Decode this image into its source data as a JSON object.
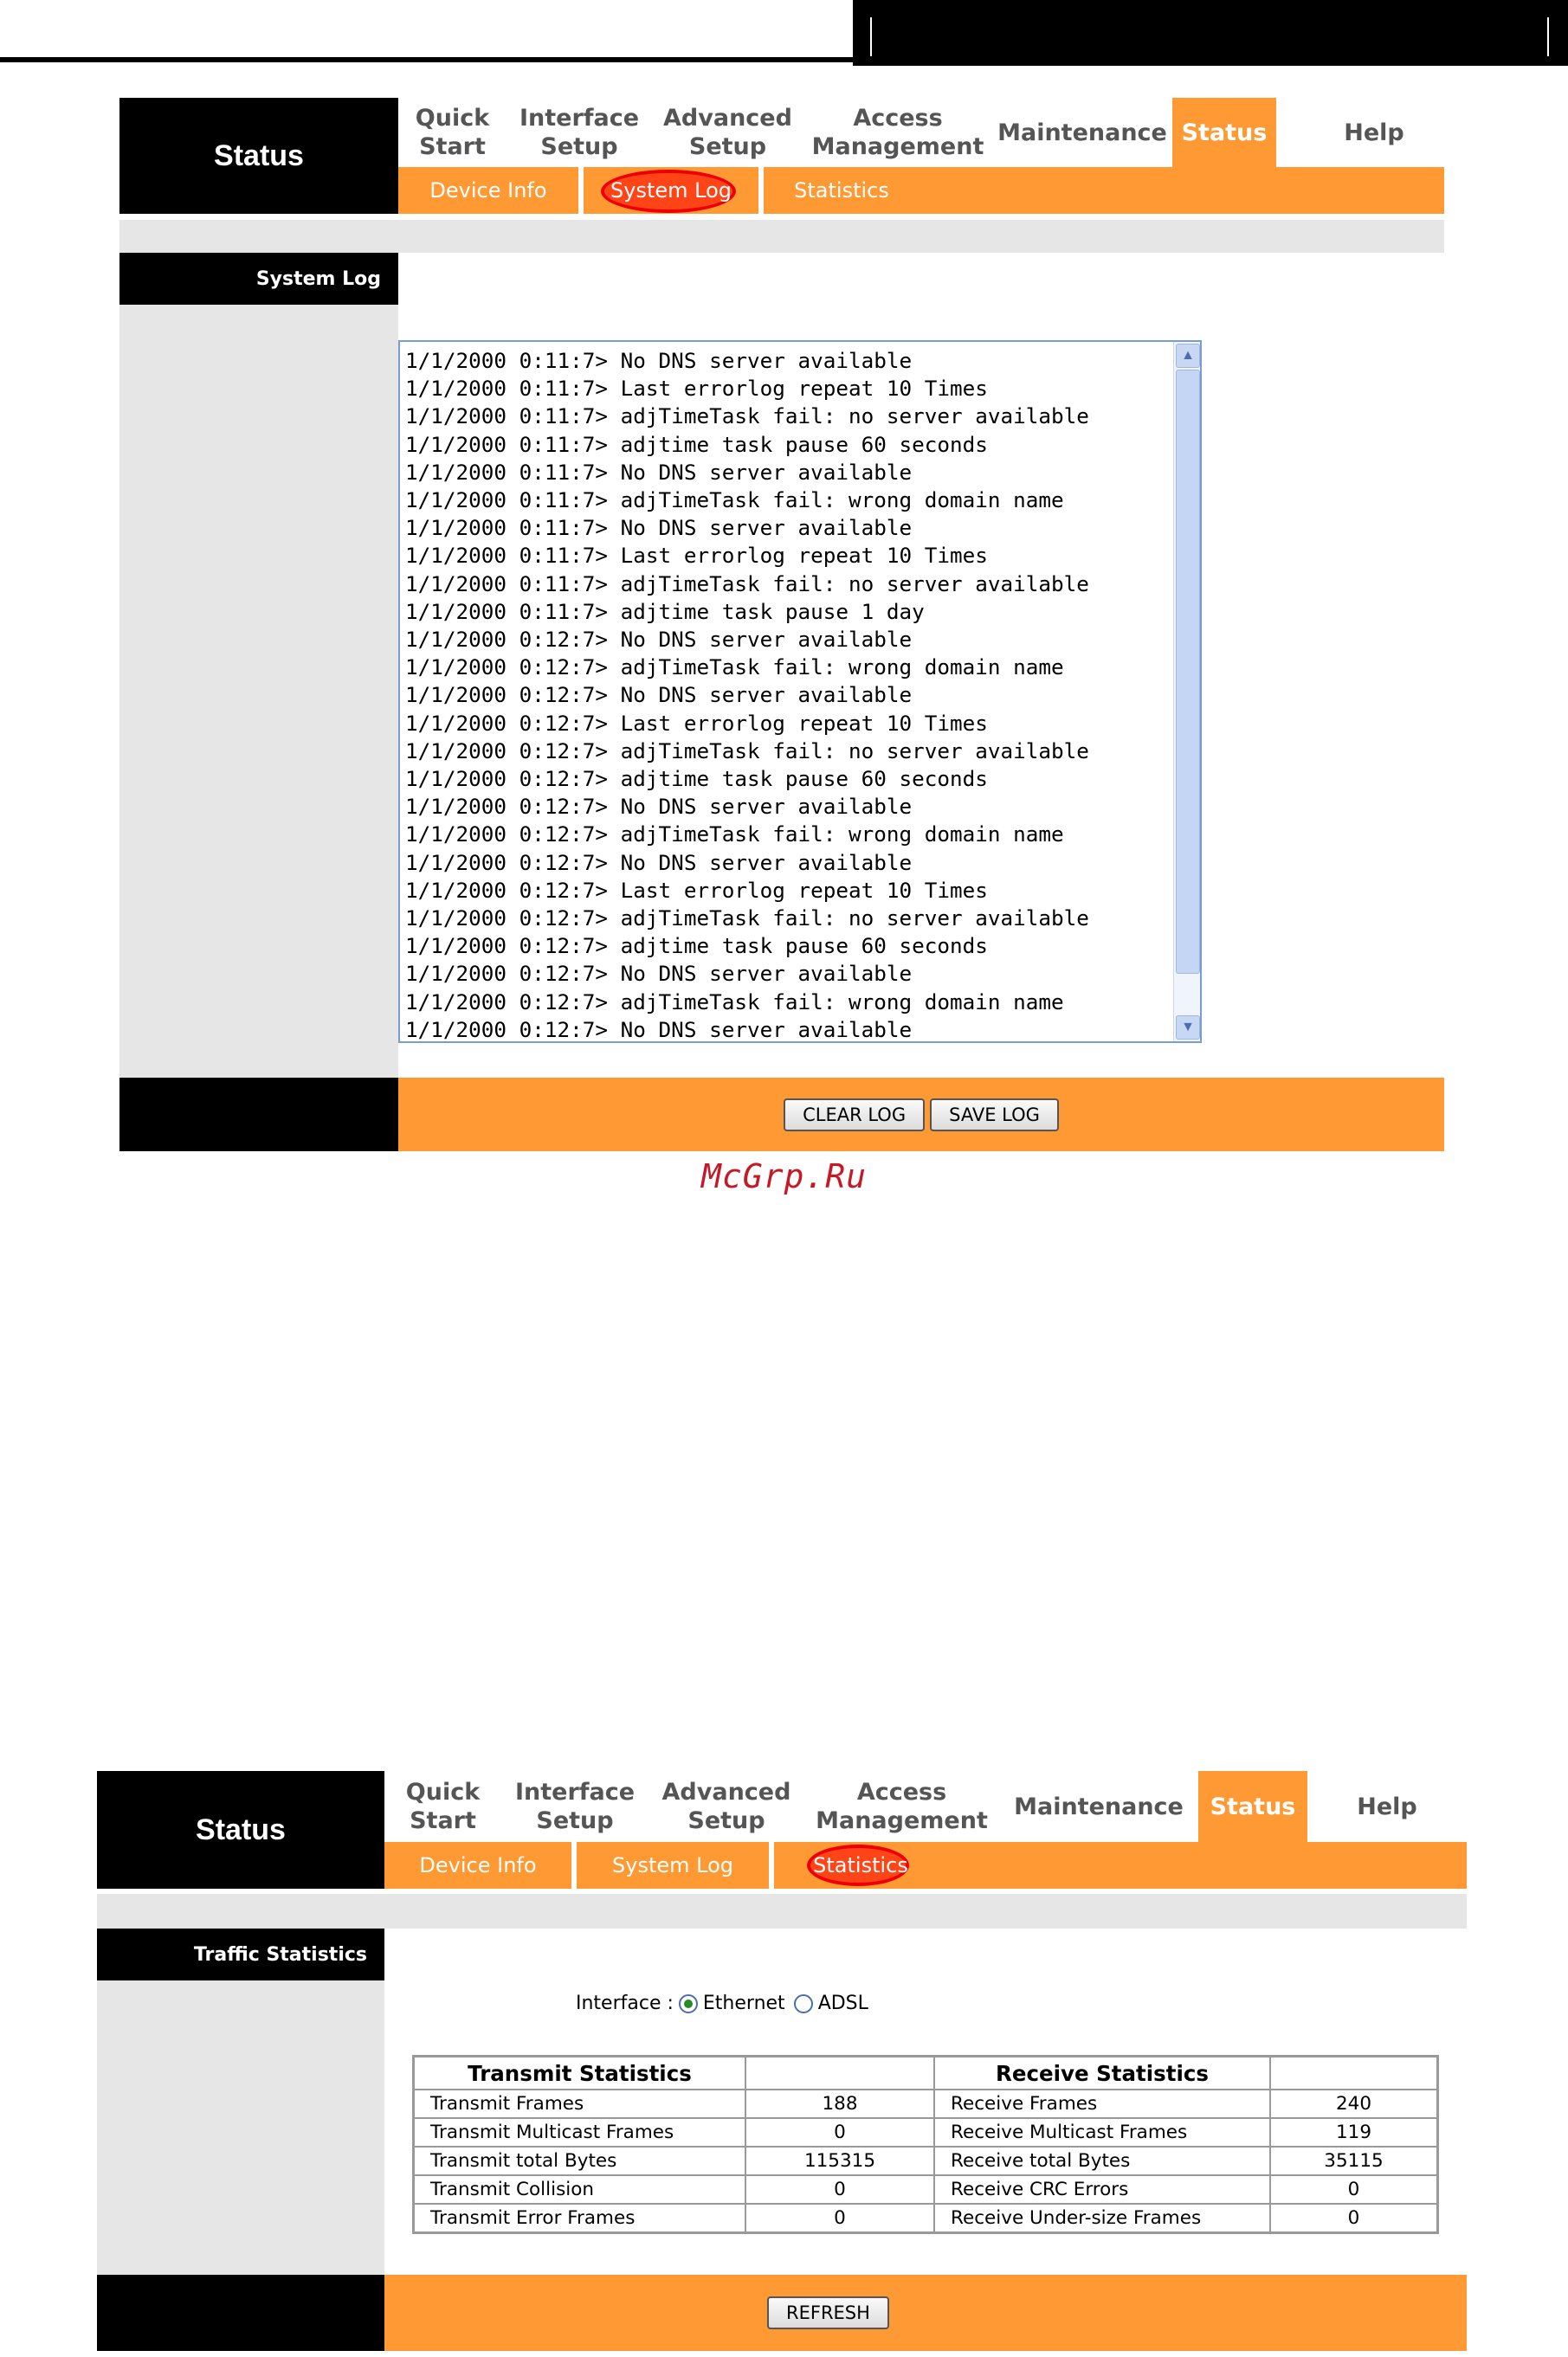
{
  "nav_items": [
    {
      "label_line1": "Quick",
      "label_line2": "Start"
    },
    {
      "label_line1": "Interface",
      "label_line2": "Setup"
    },
    {
      "label_line1": "Advanced",
      "label_line2": "Setup"
    },
    {
      "label_line1": "Access",
      "label_line2": "Management"
    },
    {
      "label_line1": "Maintenance",
      "label_line2": ""
    },
    {
      "label_line1": "Status",
      "label_line2": ""
    },
    {
      "label_line1": "Help",
      "label_line2": ""
    }
  ],
  "brand": "Status",
  "subnav": {
    "device_info": "Device Info",
    "system_log": "System Log",
    "statistics": "Statistics"
  },
  "syslog": {
    "section_label": "System Log",
    "lines": [
      "1/1/2000 0:11:7> No DNS server available",
      "1/1/2000 0:11:7> Last errorlog repeat 10 Times",
      "1/1/2000 0:11:7> adjTimeTask fail: no server available",
      "1/1/2000 0:11:7> adjtime task pause 60 seconds",
      "1/1/2000 0:11:7> No DNS server available",
      "1/1/2000 0:11:7> adjTimeTask fail: wrong domain name",
      "1/1/2000 0:11:7> No DNS server available",
      "1/1/2000 0:11:7> Last errorlog repeat 10 Times",
      "1/1/2000 0:11:7> adjTimeTask fail: no server available",
      "1/1/2000 0:11:7> adjtime task pause 1 day",
      "1/1/2000 0:12:7> No DNS server available",
      "1/1/2000 0:12:7> adjTimeTask fail: wrong domain name",
      "1/1/2000 0:12:7> No DNS server available",
      "1/1/2000 0:12:7> Last errorlog repeat 10 Times",
      "1/1/2000 0:12:7> adjTimeTask fail: no server available",
      "1/1/2000 0:12:7> adjtime task pause 60 seconds",
      "1/1/2000 0:12:7> No DNS server available",
      "1/1/2000 0:12:7> adjTimeTask fail: wrong domain name",
      "1/1/2000 0:12:7> No DNS server available",
      "1/1/2000 0:12:7> Last errorlog repeat 10 Times",
      "1/1/2000 0:12:7> adjTimeTask fail: no server available",
      "1/1/2000 0:12:7> adjtime task pause 60 seconds",
      "1/1/2000 0:12:7> No DNS server available",
      "1/1/2000 0:12:7> adjTimeTask fail: wrong domain name",
      "1/1/2000 0:12:7> No DNS server available"
    ],
    "clear_log": "CLEAR LOG",
    "save_log": "SAVE LOG"
  },
  "watermark": "McGrp.Ru",
  "traffic": {
    "section_label": "Traffic Statistics",
    "interface_label": "Interface :",
    "ethernet": "Ethernet",
    "adsl": "ADSL",
    "transmit_header": "Transmit Statistics",
    "receive_header": "Receive Statistics",
    "rows": [
      {
        "tx_label": "Transmit Frames",
        "tx_value": "188",
        "rx_label": "Receive Frames",
        "rx_value": "240"
      },
      {
        "tx_label": "Transmit Multicast Frames",
        "tx_value": "0",
        "rx_label": "Receive Multicast Frames",
        "rx_value": "119"
      },
      {
        "tx_label": "Transmit total Bytes",
        "tx_value": "115315",
        "rx_label": "Receive total Bytes",
        "rx_value": "35115"
      },
      {
        "tx_label": "Transmit Collision",
        "tx_value": "0",
        "rx_label": "Receive CRC Errors",
        "rx_value": "0"
      },
      {
        "tx_label": "Transmit Error Frames",
        "tx_value": "0",
        "rx_label": "Receive Under-size Frames",
        "rx_value": "0"
      }
    ],
    "refresh": "REFRESH"
  },
  "colors": {
    "accent": "#ff9933",
    "black": "#000000",
    "grey": "#e6e6e6",
    "highlight": "#ff0000"
  }
}
